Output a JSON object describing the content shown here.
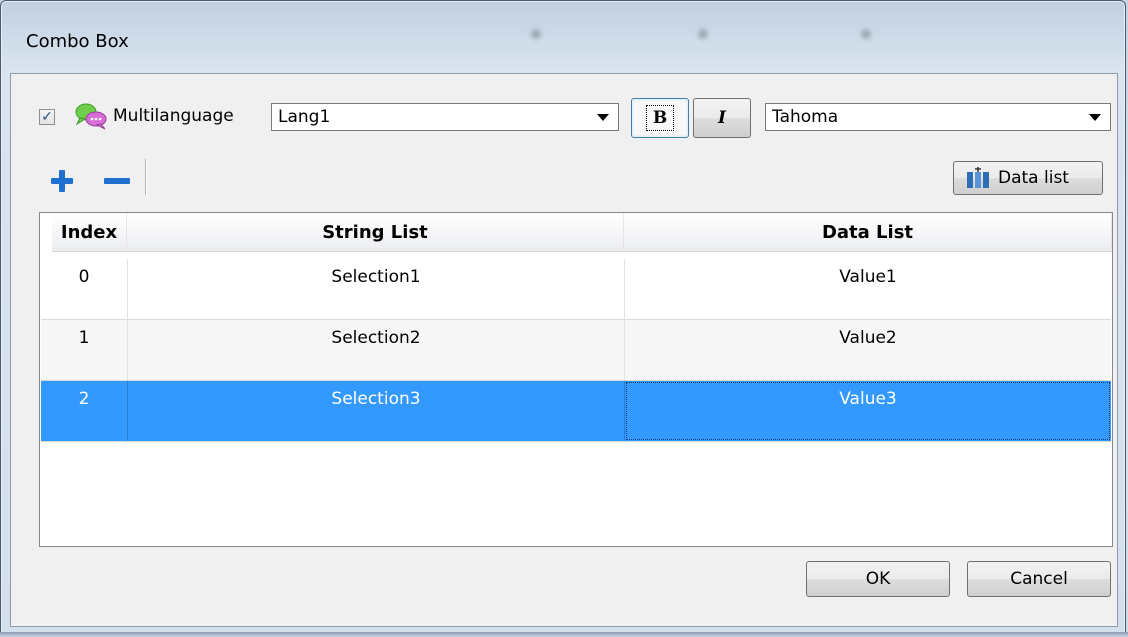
{
  "window": {
    "title": "Combo Box"
  },
  "toolbar": {
    "multilanguage_checked": true,
    "multilanguage_label": "Multilanguage",
    "language_value": "Lang1",
    "bold_label": "B",
    "italic_label": "I",
    "font_value": "Tahoma",
    "add_icon": "plus-icon",
    "remove_icon": "minus-icon",
    "data_list_label": "Data list"
  },
  "table": {
    "columns": [
      "Index",
      "String List",
      "Data List"
    ],
    "rows": [
      {
        "index": "0",
        "string": "Selection1",
        "data": "Value1"
      },
      {
        "index": "1",
        "string": "Selection2",
        "data": "Value2"
      },
      {
        "index": "2",
        "string": "Selection3",
        "data": "Value3"
      }
    ],
    "selected_row": 2
  },
  "buttons": {
    "ok": "OK",
    "cancel": "Cancel"
  },
  "colors": {
    "selection": "#3399ff",
    "accent_icon": "#1f6fd1"
  }
}
